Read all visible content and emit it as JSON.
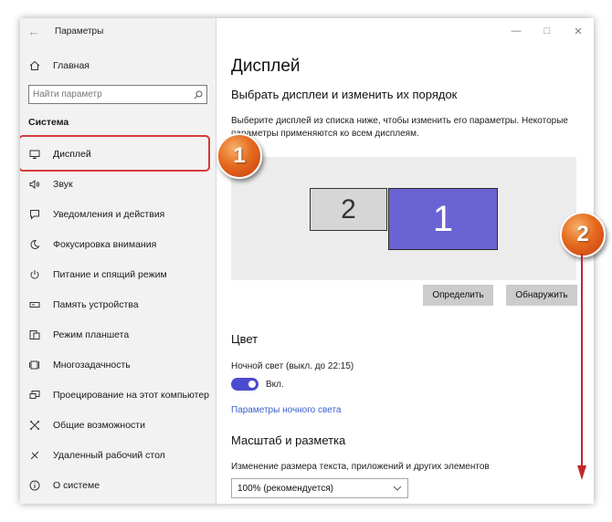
{
  "window": {
    "title": "Параметры"
  },
  "sidebar": {
    "home_label": "Главная",
    "search_placeholder": "Найти параметр",
    "section_title": "Система",
    "items": [
      {
        "label": "Дисплей",
        "icon": "monitor-icon",
        "active": true
      },
      {
        "label": "Звук",
        "icon": "speaker-icon"
      },
      {
        "label": "Уведомления и действия",
        "icon": "notification-icon"
      },
      {
        "label": "Фокусировка внимания",
        "icon": "moon-icon"
      },
      {
        "label": "Питание и спящий режим",
        "icon": "power-icon"
      },
      {
        "label": "Память устройства",
        "icon": "storage-icon"
      },
      {
        "label": "Режим планшета",
        "icon": "tablet-icon"
      },
      {
        "label": "Многозадачность",
        "icon": "multitask-icon"
      },
      {
        "label": "Проецирование на этот компьютер",
        "icon": "projection-icon"
      },
      {
        "label": "Общие возможности",
        "icon": "shared-icon"
      },
      {
        "label": "Удаленный рабочий стол",
        "icon": "remote-desktop-icon"
      },
      {
        "label": "О системе",
        "icon": "info-icon"
      }
    ]
  },
  "main": {
    "page_title": "Дисплей",
    "subheading": "Выбрать дисплеи и изменить их порядок",
    "description": "Выберите дисплей из списка ниже, чтобы изменить его параметры. Некоторые параметры применяются ко всем дисплеям.",
    "monitors": [
      {
        "label": "2"
      },
      {
        "label": "1",
        "selected": true
      }
    ],
    "identify_button": "Определить",
    "detect_button": "Обнаружить",
    "color_heading": "Цвет",
    "night_light_label": "Ночной свет (выкл. до 22:15)",
    "toggle_state": "Вкл.",
    "night_light_link": "Параметры ночного света",
    "scale_heading": "Масштаб и разметка",
    "scale_description": "Изменение размера текста, приложений и других элементов",
    "scale_value": "100% (рекомендуется)"
  },
  "annotations": {
    "badge1": "1",
    "badge2": "2"
  },
  "colors": {
    "accent": "#4c4ad0",
    "selected_monitor": "#6a63d4",
    "highlight": "#d63a3a",
    "badge": "#e56b1f",
    "link": "#3a5fcd"
  }
}
